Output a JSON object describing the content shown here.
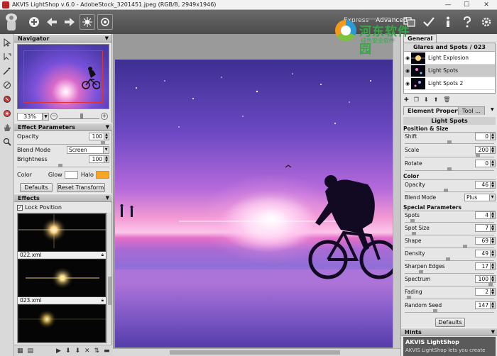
{
  "window": {
    "title": "AKVIS LightShop v.6.0 - AdobeStock_3201451.jpeg (RGB/8, 2949x1946)",
    "min_label": "—",
    "max_label": "☐",
    "close_label": "✕"
  },
  "toolbar": {
    "mode_express": "Express",
    "mode_advanced": "Advanced"
  },
  "watermark": {
    "title": "河东软件园",
    "subtitle": "绿色安全软件",
    "url": "www.pc0359.cn"
  },
  "navigator": {
    "header": "Navigator",
    "zoom_value": "33%"
  },
  "effect_parameters": {
    "header": "Effect Parameters",
    "opacity_label": "Opacity",
    "opacity_value": "100",
    "blend_mode_label": "Blend Mode",
    "blend_mode_value": "Screen",
    "brightness_label": "Brightness",
    "brightness_value": "100",
    "color_label": "Color",
    "glow_label": "Glow",
    "halo_label": "Halo",
    "glow_color": "#ffffff",
    "halo_color": "#f5a623",
    "defaults_label": "Defaults",
    "reset_transform_label": "Reset Transform"
  },
  "effects": {
    "header": "Effects",
    "lock_position_label": "Lock Position",
    "items": [
      {
        "name": ""
      },
      {
        "name": "022.xml"
      },
      {
        "name": "023.xml"
      }
    ]
  },
  "right_panel": {
    "tab_general": "General",
    "effect_header": "Glares and Spots / 023",
    "layers": [
      {
        "name": "Light Explosion"
      },
      {
        "name": "Light Spots"
      },
      {
        "name": "Light Spots 2"
      }
    ],
    "tab_element_properties": "Element Properties",
    "tab_tool": "Tool ...",
    "element_title": "Light Spots",
    "group_position_size": "Position & Size",
    "shift_label": "Shift",
    "shift_value": "0",
    "scale_label": "Scale",
    "scale_value": "200",
    "rotate_label": "Rotate",
    "rotate_value": "0",
    "group_color": "Color",
    "opacity_label": "Opacity",
    "opacity_value": "46",
    "blend_mode_label": "Blend Mode",
    "blend_mode_value": "Plus",
    "group_special": "Special Parameters",
    "spots_label": "Spots",
    "spots_value": "4",
    "spot_size_label": "Spot Size",
    "spot_size_value": "7",
    "shape_label": "Shape",
    "shape_value": "69",
    "density_label": "Density",
    "density_value": "49",
    "sharpen_label": "Sharpen Edges",
    "sharpen_value": "17",
    "spectrum_label": "Spectrum",
    "spectrum_value": "100",
    "fading_label": "Fading",
    "fading_value": "2",
    "seed_label": "Random Seed",
    "seed_value": "147",
    "defaults_label": "Defaults",
    "hints_header": "Hints",
    "hints_title": "AKVIS LightShop",
    "hints_text": "AKVIS LightShop lets you create"
  },
  "colors": {
    "toolbar": "#555555",
    "panel": "#e6e6e6",
    "selection": "#c9c9c9"
  }
}
